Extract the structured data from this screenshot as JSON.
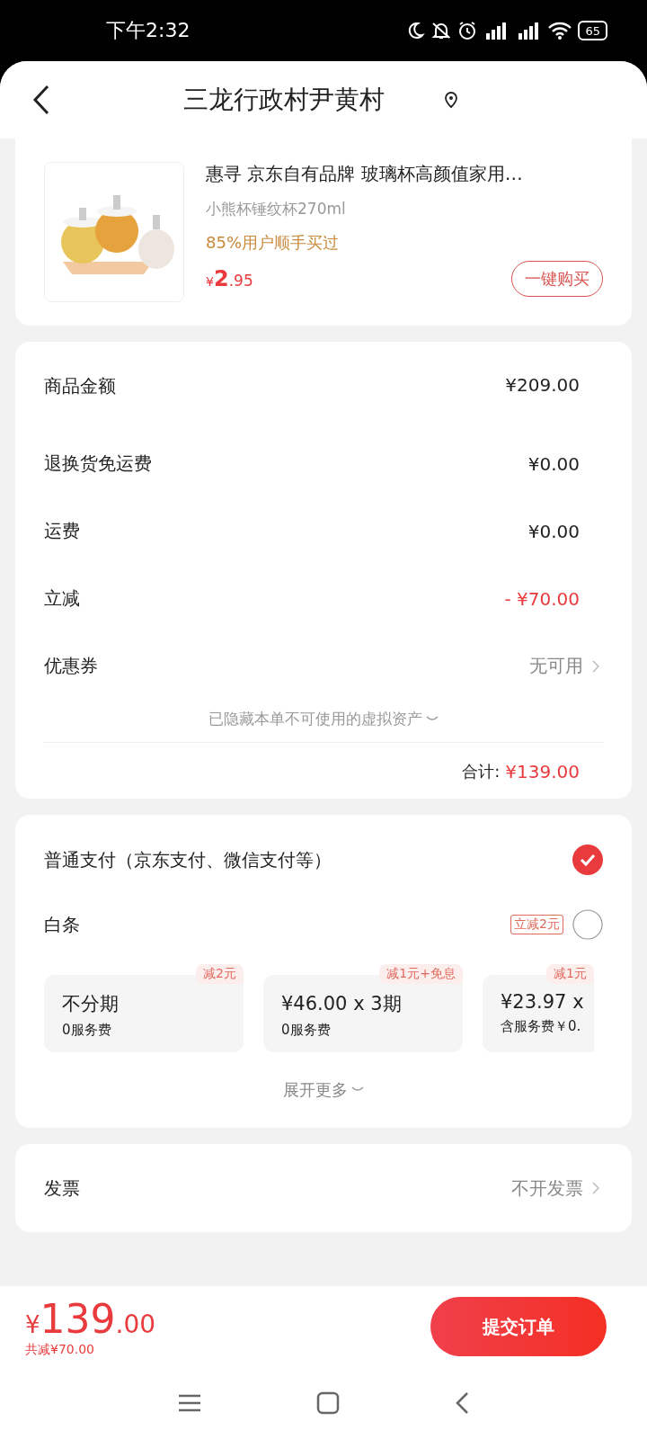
{
  "status_bar": {
    "time": "下午2:32",
    "battery": "65"
  },
  "header": {
    "title": "三龙行政村尹黄村"
  },
  "recommend": {
    "product": {
      "kind": "picture",
      "title": "惠寻 京东自有品牌 玻璃杯高颜值家用…",
      "spec": "小熊杯锤纹杯270ml",
      "hint": "85%用户顺手买过",
      "price_symbol": "¥",
      "price_int": "2",
      "price_dec": ".95",
      "button": "一键购买"
    }
  },
  "summary": {
    "rows": [
      {
        "label": "商品金额",
        "value": "¥209.00",
        "kind": "plain"
      },
      {
        "label": "退换货免运费",
        "value": "¥0.00",
        "kind": "plain"
      },
      {
        "label": "运费",
        "value": "¥0.00",
        "kind": "plain"
      },
      {
        "label": "立减",
        "value": "- ¥70.00",
        "kind": "discount"
      },
      {
        "label": "优惠券",
        "value": "无可用",
        "kind": "link"
      }
    ],
    "hidden_note": "已隐藏本单不可使用的虚拟资产",
    "total_label": "合计:",
    "total_value": "¥139.00"
  },
  "payment": {
    "methods": [
      {
        "label": "普通支付（京东支付、微信支付等）",
        "selected": true
      },
      {
        "label": "白条",
        "tag": "立减2元",
        "selected": false
      }
    ],
    "plans": [
      {
        "title": "不分期",
        "note": "0服务费",
        "badge": "减2元"
      },
      {
        "title": "¥46.00 x 3期",
        "note": "0服务费",
        "badge": "减1元+免息"
      },
      {
        "title": "¥23.97 x",
        "note": "含服务费￥0.",
        "badge": "减1元"
      }
    ],
    "more": "展开更多"
  },
  "invoice": {
    "label": "发票",
    "value": "不开发票"
  },
  "footer": {
    "symbol": "¥",
    "amount_int": "139",
    "amount_dec": ".00",
    "saved": "共减¥70.00",
    "submit": "提交订单"
  }
}
